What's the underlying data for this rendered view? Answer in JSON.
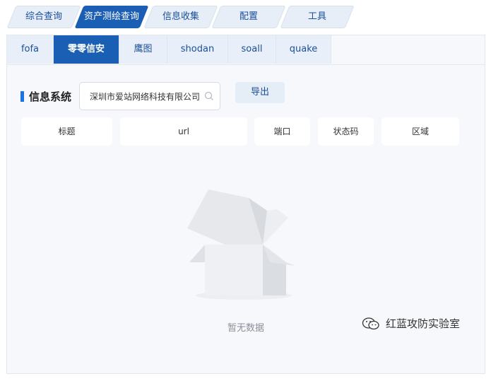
{
  "top_tabs": [
    {
      "label": "综合查询",
      "active": false
    },
    {
      "label": "资产测绘查询",
      "active": true
    },
    {
      "label": "信息收集",
      "active": false
    },
    {
      "label": "配置",
      "active": false
    },
    {
      "label": "工具",
      "active": false
    }
  ],
  "sub_tabs": [
    {
      "label": "fofa",
      "active": false
    },
    {
      "label": "零零信安",
      "active": true
    },
    {
      "label": "鹰图",
      "active": false
    },
    {
      "label": "shodan",
      "active": false
    },
    {
      "label": "soall",
      "active": false
    },
    {
      "label": "quake",
      "active": false
    }
  ],
  "section": {
    "title": "信息系统"
  },
  "search": {
    "value": "深圳市爱站网络科技有限公司"
  },
  "export": {
    "label": "导出"
  },
  "table": {
    "columns": [
      "标题",
      "url",
      "端口",
      "状态码",
      "区域"
    ]
  },
  "empty": {
    "text": "暂无数据"
  },
  "watermark": {
    "text": "红蓝攻防实验室"
  },
  "colors": {
    "accent": "#1a5fb4",
    "tab_bg": "#e7eef8",
    "panel_bg": "#f6f8fb"
  }
}
